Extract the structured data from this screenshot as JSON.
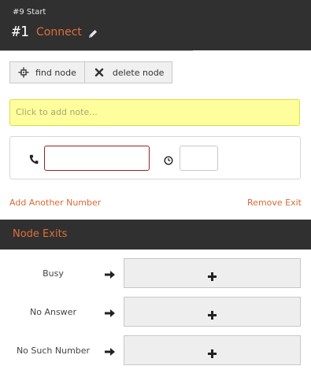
{
  "header": {
    "subtitle": "#9 Start",
    "number": "#1",
    "title": "Connect",
    "edit_icon": "pencil-icon"
  },
  "toolbar": {
    "find_label": "find node",
    "find_icon": "crosshair-icon",
    "delete_label": "delete node",
    "delete_icon": "x-icon"
  },
  "note": {
    "placeholder": "Click to add note..."
  },
  "phone": {
    "phone_icon": "phone-icon",
    "phone_value": "",
    "clock_icon": "clock-icon",
    "timeout_value": ""
  },
  "links": {
    "add_number": "Add Another Number",
    "remove_exit": "Remove Exit"
  },
  "exits": {
    "title": "Node Exits",
    "rows": [
      {
        "label": "Busy"
      },
      {
        "label": "No Answer"
      },
      {
        "label": "No Such Number"
      }
    ]
  },
  "colors": {
    "header_bg": "#303030",
    "accent": "#e06e3a",
    "note_bg": "#fefe9c",
    "invalid_border": "#9b2020"
  }
}
